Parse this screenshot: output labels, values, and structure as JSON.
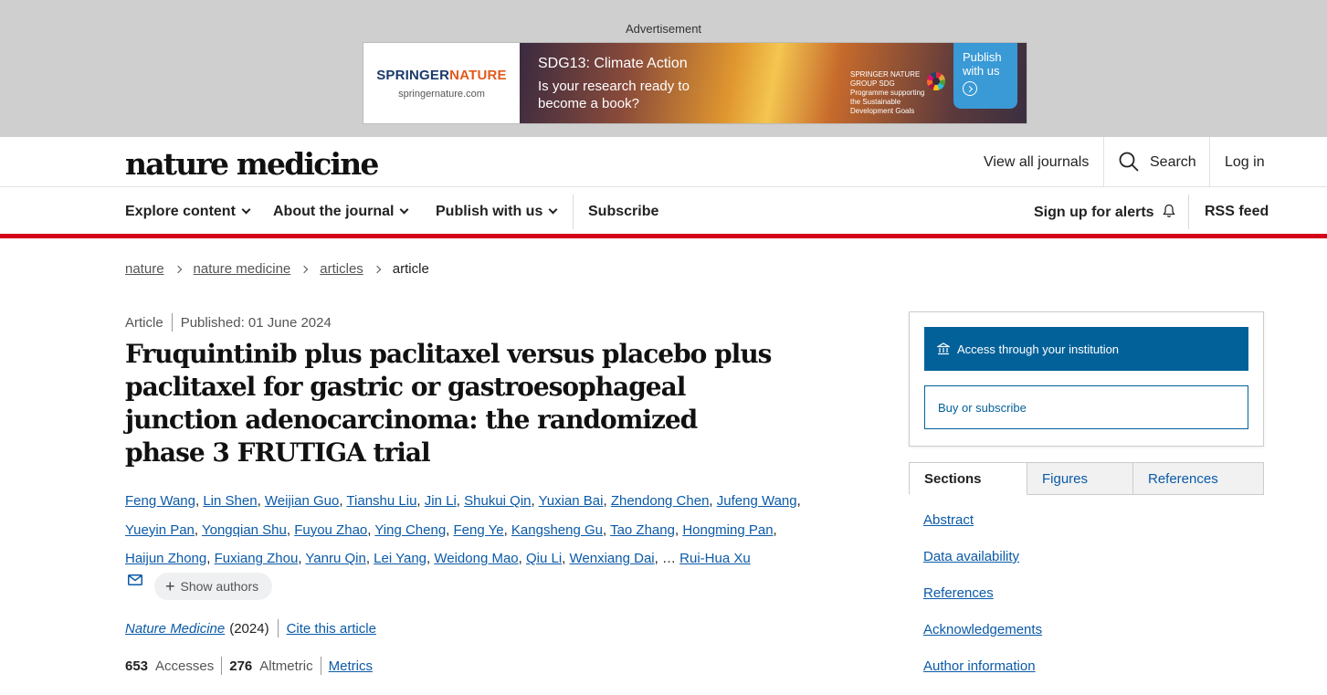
{
  "ad": {
    "label": "Advertisement",
    "brand_main": "SPRINGER",
    "brand_accent": "NATURE",
    "brand_url": "springernature.com",
    "headline": "SDG13: Climate Action",
    "subline": "Is your research ready to become a book?",
    "sdg_text": "SPRINGER NATURE GROUP SDG Programme supporting the Sustainable Development Goals",
    "cta": "Publish with us"
  },
  "header": {
    "logo": "nature medicine",
    "view_all": "View all journals",
    "search": "Search",
    "login": "Log in"
  },
  "nav": {
    "explore": "Explore content",
    "about": "About the journal",
    "publish": "Publish with us",
    "subscribe": "Subscribe",
    "alerts": "Sign up for alerts",
    "rss": "RSS feed"
  },
  "breadcrumb": [
    "nature",
    "nature medicine",
    "articles",
    "article"
  ],
  "article": {
    "type": "Article",
    "published": "Published: 01 June 2024",
    "title": "Fruquintinib plus paclitaxel versus placebo plus paclitaxel for gastric or gastroesophageal junction adenocarcinoma: the randomized phase 3 FRUTIGA trial",
    "authors": [
      "Feng Wang",
      "Lin Shen",
      "Weijian Guo",
      "Tianshu Liu",
      "Jin Li",
      "Shukui Qin",
      "Yuxian Bai",
      "Zhendong Chen",
      "Jufeng Wang",
      "Yueyin Pan",
      "Yongqian Shu",
      "Fuyou Zhao",
      "Ying Cheng",
      "Feng Ye",
      "Kangsheng Gu",
      "Tao Zhang",
      "Hongming Pan",
      "Haijun Zhong",
      "Fuxiang Zhou",
      "Yanru Qin",
      "Lei Yang",
      "Weidong Mao",
      "Qiu Li",
      "Wenxiang Dai"
    ],
    "ellipsis": "…",
    "last_author": "Rui-Hua Xu",
    "show_authors": "Show authors",
    "journal": "Nature Medicine",
    "year": "(2024)",
    "cite": "Cite this article",
    "accesses_count": "653",
    "accesses_label": "Accesses",
    "altmetric_count": "276",
    "altmetric_label": "Altmetric",
    "metrics": "Metrics"
  },
  "sidebar": {
    "access_institution": "Access through your institution",
    "buy": "Buy or subscribe",
    "tabs": [
      "Sections",
      "Figures",
      "References"
    ],
    "toc": [
      "Abstract",
      "Data availability",
      "References",
      "Acknowledgements",
      "Author information"
    ]
  },
  "colors": {
    "accent_red": "#d5001a",
    "link_blue": "#0b5aa8",
    "button_blue": "#03619a"
  }
}
